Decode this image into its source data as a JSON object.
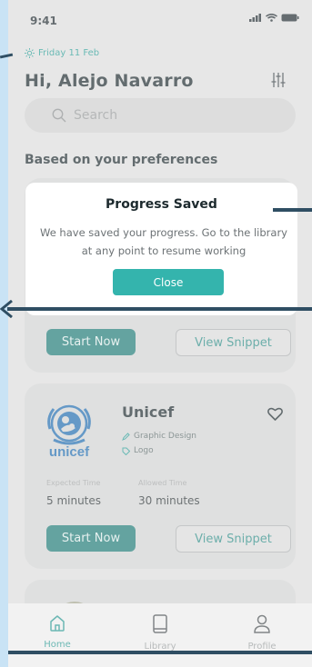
{
  "status": {
    "time": "9:41"
  },
  "header": {
    "date": "Friday 11 Feb",
    "greeting": "Hi, Alejo Navarro",
    "icon_sun": "sun-icon",
    "icon_filter": "sliders-icon"
  },
  "search": {
    "placeholder": "Search",
    "icon": "search-icon"
  },
  "section": {
    "title": "Based on your preferences"
  },
  "card1": {
    "primary": "Start Now",
    "secondary": "View Snippet"
  },
  "card2": {
    "title": "Unicef",
    "tags": [
      "Graphic Design",
      "Logo"
    ],
    "expected_label": "Expected Time",
    "allowed_label": "Allowed Time",
    "expected_value": "5 minutes",
    "allowed_value": "30 minutes",
    "primary": "Start Now",
    "secondary": "View Snippet",
    "logo_text": "unicef"
  },
  "tabs": [
    {
      "label": "Home",
      "icon": "home-icon",
      "active": true
    },
    {
      "label": "Library",
      "icon": "book-icon",
      "active": false
    },
    {
      "label": "Profile",
      "icon": "user-icon",
      "active": false
    }
  ],
  "modal": {
    "title": "Progress Saved",
    "body": "We have saved your progress. Go to the library at any point to resume working",
    "close": "Close"
  },
  "colors": {
    "accent": "#2a9f98",
    "primary_button": "#1e7f7a",
    "modal_button": "#34b4ad",
    "annotation": "#2f4e63"
  }
}
